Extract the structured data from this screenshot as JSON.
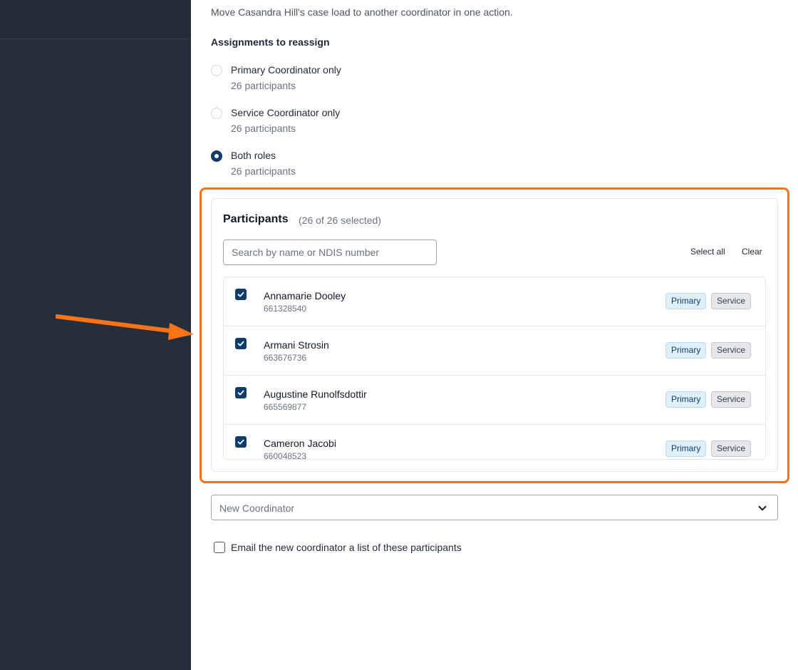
{
  "header": {
    "description": "Move Casandra Hill's case load to another coordinator in one action."
  },
  "assignments": {
    "label": "Assignments to reassign",
    "options": [
      {
        "label": "Primary Coordinator only",
        "count": "26 participants",
        "checked": false
      },
      {
        "label": "Service Coordinator only",
        "count": "26 participants",
        "checked": false
      },
      {
        "label": "Both roles",
        "count": "26 participants",
        "checked": true
      }
    ]
  },
  "participants": {
    "title": "Participants",
    "count": "(26 of 26 selected)",
    "search_placeholder": "Search by name or NDIS number",
    "select_all_label": "Select all",
    "clear_label": "Clear",
    "rows": [
      {
        "name": "Annamarie Dooley",
        "number": "661328540",
        "badge_primary": "Primary",
        "badge_service": "Service",
        "checked": true
      },
      {
        "name": "Armani Strosin",
        "number": "663676736",
        "badge_primary": "Primary",
        "badge_service": "Service",
        "checked": true
      },
      {
        "name": "Augustine Runolfsdottir",
        "number": "665569877",
        "badge_primary": "Primary",
        "badge_service": "Service",
        "checked": true
      },
      {
        "name": "Cameron Jacobi",
        "number": "660048523",
        "badge_primary": "Primary",
        "badge_service": "Service",
        "checked": true
      }
    ]
  },
  "new_coordinator": {
    "placeholder": "New Coordinator"
  },
  "email_option": {
    "label": "Email the new coordinator a list of these participants",
    "checked": false
  },
  "colors": {
    "accent": "#0f3d6b",
    "highlight": "#f97316",
    "sidebar": "#262e3b"
  },
  "icons": {
    "checkbox": "checkmark-icon",
    "select": "chevron-down-icon",
    "annotation": "orange-arrow-icon"
  }
}
